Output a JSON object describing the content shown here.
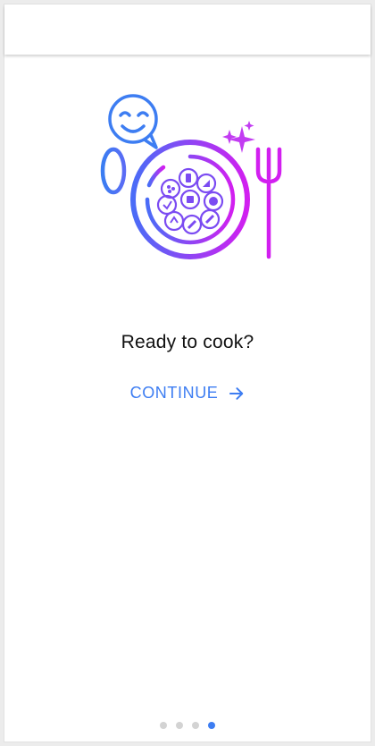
{
  "screen": {
    "title": "Ready to cook?",
    "continue_label": "CONTINUE"
  },
  "icons": {
    "hero": "chef-plate-illustration",
    "continue": "arrow-right-icon"
  },
  "pager": {
    "total": 4,
    "active_index": 3
  },
  "colors": {
    "accent": "#3d7df2",
    "gradient_start": "#4a6cf7",
    "gradient_end": "#d21ff0",
    "dot_inactive": "#d3d3d3",
    "title_text": "#111111"
  }
}
